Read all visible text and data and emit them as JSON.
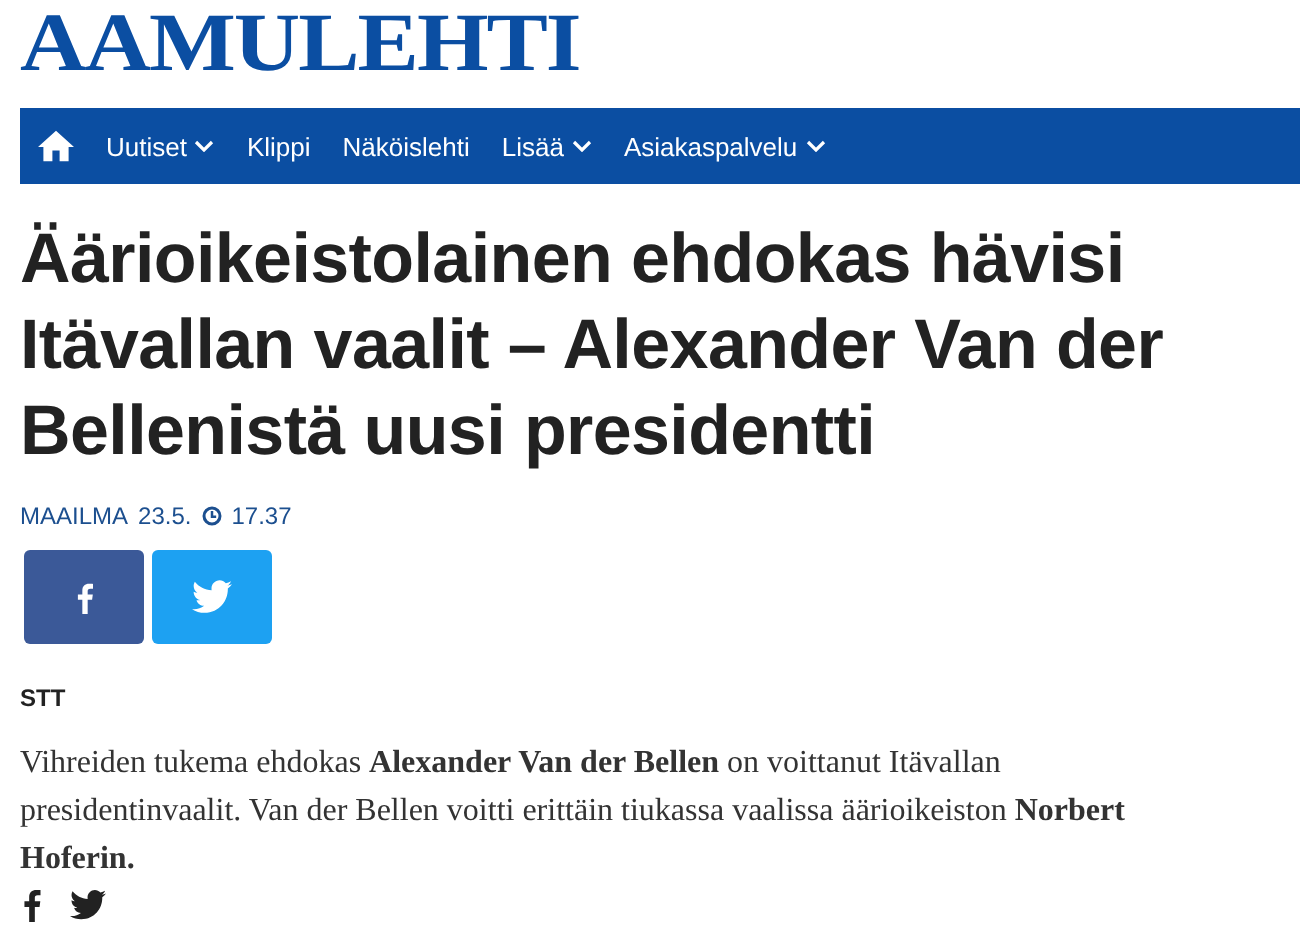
{
  "logo": "AAMULEHTI",
  "nav": [
    {
      "label": "Uutiset",
      "has_menu": true
    },
    {
      "label": "Klippi",
      "has_menu": false
    },
    {
      "label": "Näköislehti",
      "has_menu": false
    },
    {
      "label": "Lisää",
      "has_menu": true
    },
    {
      "label": "Asiakaspalvelu",
      "has_menu": true
    }
  ],
  "headline": "Äärioikeistolainen ehdokas hävisi Itävallan vaalit – Alexander Van der Bellenistä uusi presidentti",
  "meta": {
    "section": "MAAILMA",
    "date": "23.5.",
    "time": "17.37"
  },
  "byline": "STT",
  "lead": "Vihreiden tukema ehdokas **Alexander Van der Bellen** on voittanut Itävallan presidentinvaalit. Van der Bellen voitti erittäin tiukassa vaalissa äärioikeiston **Norbert Hoferin.**"
}
